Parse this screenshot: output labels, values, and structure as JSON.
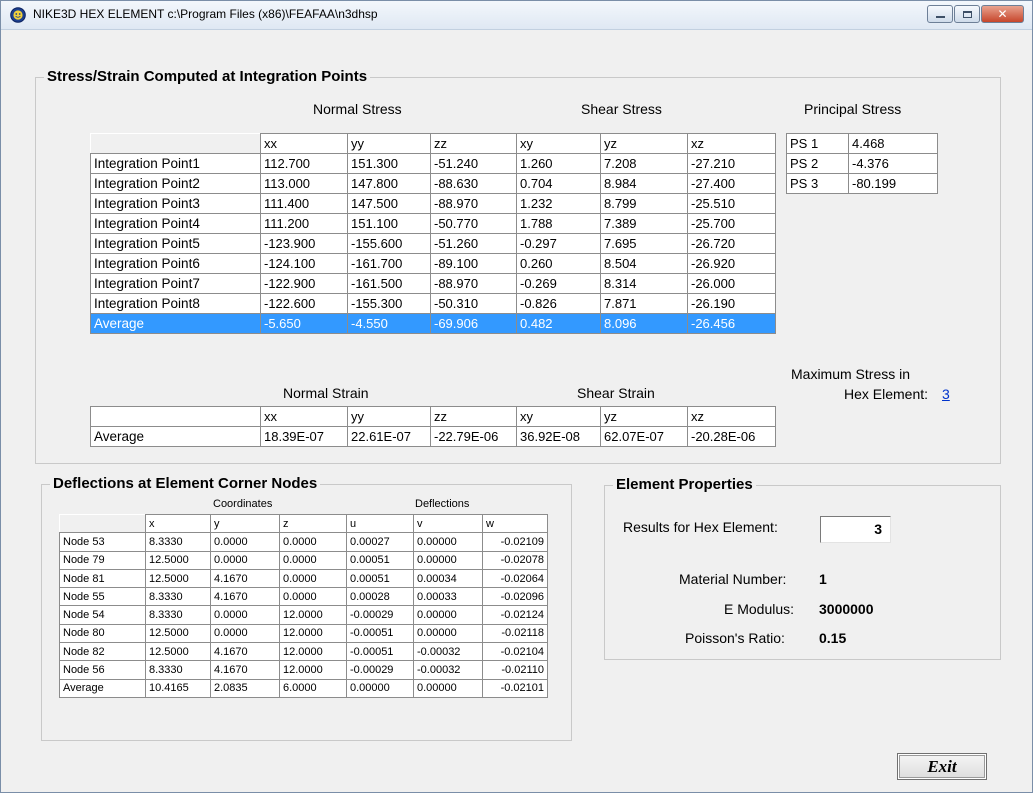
{
  "window": {
    "title": "NIKE3D HEX ELEMENT   c:\\Program Files (x86)\\FEAFAA\\n3dhsp",
    "buttons": {
      "minimize": "minimize",
      "maximize": "maximize",
      "close": "✕"
    }
  },
  "stress_group": {
    "title": "Stress/Strain Computed at Integration Points",
    "normal_stress_label": "Normal Stress",
    "shear_stress_label": "Shear Stress",
    "principal_stress_label": "Principal Stress",
    "columns": [
      "xx",
      "yy",
      "zz",
      "xy",
      "yz",
      "xz"
    ],
    "rows": [
      {
        "label": "Integration Point1",
        "values": [
          "112.700",
          "151.300",
          "-51.240",
          "1.260",
          "7.208",
          "-27.210"
        ]
      },
      {
        "label": "Integration Point2",
        "values": [
          "113.000",
          "147.800",
          "-88.630",
          "0.704",
          "8.984",
          "-27.400"
        ]
      },
      {
        "label": "Integration Point3",
        "values": [
          "111.400",
          "147.500",
          "-88.970",
          "1.232",
          "8.799",
          "-25.510"
        ]
      },
      {
        "label": "Integration Point4",
        "values": [
          "111.200",
          "151.100",
          "-50.770",
          "1.788",
          "7.389",
          "-25.700"
        ]
      },
      {
        "label": "Integration Point5",
        "values": [
          "-123.900",
          "-155.600",
          "-51.260",
          "-0.297",
          "7.695",
          "-26.720"
        ]
      },
      {
        "label": "Integration Point6",
        "values": [
          "-124.100",
          "-161.700",
          "-89.100",
          "0.260",
          "8.504",
          "-26.920"
        ]
      },
      {
        "label": "Integration Point7",
        "values": [
          "-122.900",
          "-161.500",
          "-88.970",
          "-0.269",
          "8.314",
          "-26.000"
        ]
      },
      {
        "label": "Integration Point8",
        "values": [
          "-122.600",
          "-155.300",
          "-50.310",
          "-0.826",
          "7.871",
          "-26.190"
        ]
      },
      {
        "label": "Average",
        "values": [
          "-5.650",
          "-4.550",
          "-69.906",
          "0.482",
          "8.096",
          "-26.456"
        ]
      }
    ],
    "principal": [
      {
        "label": "PS 1",
        "value": "4.468"
      },
      {
        "label": "PS 2",
        "value": "-4.376"
      },
      {
        "label": "PS 3",
        "value": "-80.199"
      }
    ],
    "normal_strain_label": "Normal Strain",
    "shear_strain_label": "Shear Strain",
    "strain_columns": [
      "xx",
      "yy",
      "zz",
      "xy",
      "yz",
      "xz"
    ],
    "strain_row": {
      "label": "Average",
      "values": [
        "18.39E-07",
        "22.61E-07",
        "-22.79E-06",
        "36.92E-08",
        "62.07E-07",
        "-20.28E-06"
      ]
    },
    "max_stress_line1": "Maximum Stress in",
    "max_stress_line2": "Hex Element:",
    "max_stress_link": "3"
  },
  "deflections_group": {
    "title": "Deflections at Element Corner Nodes",
    "coordinates_label": "Coordinates",
    "deflections_label": "Deflections",
    "columns": [
      "x",
      "y",
      "z",
      "u",
      "v",
      "w"
    ],
    "rows": [
      {
        "label": "Node 53",
        "values": [
          "8.3330",
          "0.0000",
          "0.0000",
          "0.00027",
          "0.00000",
          "-0.02109"
        ]
      },
      {
        "label": "Node 79",
        "values": [
          "12.5000",
          "0.0000",
          "0.0000",
          "0.00051",
          "0.00000",
          "-0.02078"
        ]
      },
      {
        "label": "Node 81",
        "values": [
          "12.5000",
          "4.1670",
          "0.0000",
          "0.00051",
          "0.00034",
          "-0.02064"
        ]
      },
      {
        "label": "Node 55",
        "values": [
          "8.3330",
          "4.1670",
          "0.0000",
          "0.00028",
          "0.00033",
          "-0.02096"
        ]
      },
      {
        "label": "Node 54",
        "values": [
          "8.3330",
          "0.0000",
          "12.0000",
          "-0.00029",
          "0.00000",
          "-0.02124"
        ]
      },
      {
        "label": "Node 80",
        "values": [
          "12.5000",
          "0.0000",
          "12.0000",
          "-0.00051",
          "0.00000",
          "-0.02118"
        ]
      },
      {
        "label": "Node 82",
        "values": [
          "12.5000",
          "4.1670",
          "12.0000",
          "-0.00051",
          "-0.00032",
          "-0.02104"
        ]
      },
      {
        "label": "Node 56",
        "values": [
          "8.3330",
          "4.1670",
          "12.0000",
          "-0.00029",
          "-0.00032",
          "-0.02110"
        ]
      },
      {
        "label": "Average",
        "values": [
          "10.4165",
          "2.0835",
          "6.0000",
          "0.00000",
          "0.00000",
          "-0.02101"
        ]
      }
    ]
  },
  "properties_group": {
    "title": "Element Properties",
    "results_label": "Results for Hex Element:",
    "results_value": "3",
    "material_label": "Material Number:",
    "material_value": "1",
    "modulus_label": "E Modulus:",
    "modulus_value": "3000000",
    "poisson_label": "Poisson's Ratio:",
    "poisson_value": "0.15"
  },
  "exit_button": {
    "label": "Exit"
  }
}
